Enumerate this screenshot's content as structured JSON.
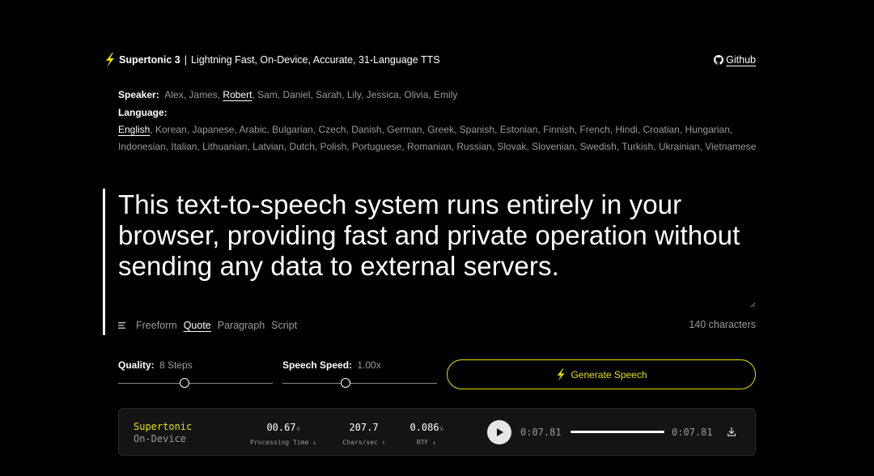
{
  "header": {
    "brand_name": "Supertonic 3",
    "separator": "|",
    "tagline": "Lightning Fast, On-Device, Accurate, 31-Language TTS",
    "github_label": "Github"
  },
  "speaker": {
    "label": "Speaker:",
    "items": [
      "Alex",
      "James",
      "Robert",
      "Sam",
      "Daniel",
      "Sarah",
      "Lily",
      "Jessica",
      "Olivia",
      "Emily"
    ],
    "selected": "Robert"
  },
  "language": {
    "label": "Language:",
    "items": [
      "English",
      "Korean",
      "Japanese",
      "Arabic",
      "Bulgarian",
      "Czech",
      "Danish",
      "German",
      "Greek",
      "Spanish",
      "Estonian",
      "Finnish",
      "French",
      "Hindi",
      "Croatian",
      "Hungarian",
      "Indonesian",
      "Italian",
      "Lithuanian",
      "Latvian",
      "Dutch",
      "Polish",
      "Portuguese",
      "Romanian",
      "Russian",
      "Slovak",
      "Slovenian",
      "Swedish",
      "Turkish",
      "Ukrainian",
      "Vietnamese"
    ],
    "selected": "English"
  },
  "input": {
    "text": "This text-to-speech system runs entirely in your browser, providing fast and private operation without sending any data to external servers.",
    "char_count": "140 characters"
  },
  "modes": {
    "items": [
      "Freeform",
      "Quote",
      "Paragraph",
      "Script"
    ],
    "selected": "Quote"
  },
  "quality": {
    "label": "Quality:",
    "value": "8 Steps",
    "level": 0.43
  },
  "speed": {
    "label": "Speech Speed:",
    "value": "1.00x",
    "level": 0.41
  },
  "generate_label": "Generate Speech",
  "player": {
    "name": "Supertonic",
    "sub": "On-Device",
    "metrics": [
      {
        "value": "00.67",
        "unit": "s",
        "caption": "Processing Time ↓"
      },
      {
        "value": "207.7",
        "unit": "",
        "caption": "Chars/sec ↑"
      },
      {
        "value": "0.086",
        "unit": "x",
        "caption": "RTF ↓"
      }
    ],
    "current_time": "0:07.81",
    "total_time": "0:07.81",
    "progress": 1.0
  },
  "colors": {
    "accent": "#e8e000",
    "background": "#000000",
    "panel": "#141414"
  },
  "icons": [
    "bolt-icon",
    "github-icon",
    "align-left-icon",
    "play-icon",
    "download-icon",
    "resize-handle-icon"
  ]
}
